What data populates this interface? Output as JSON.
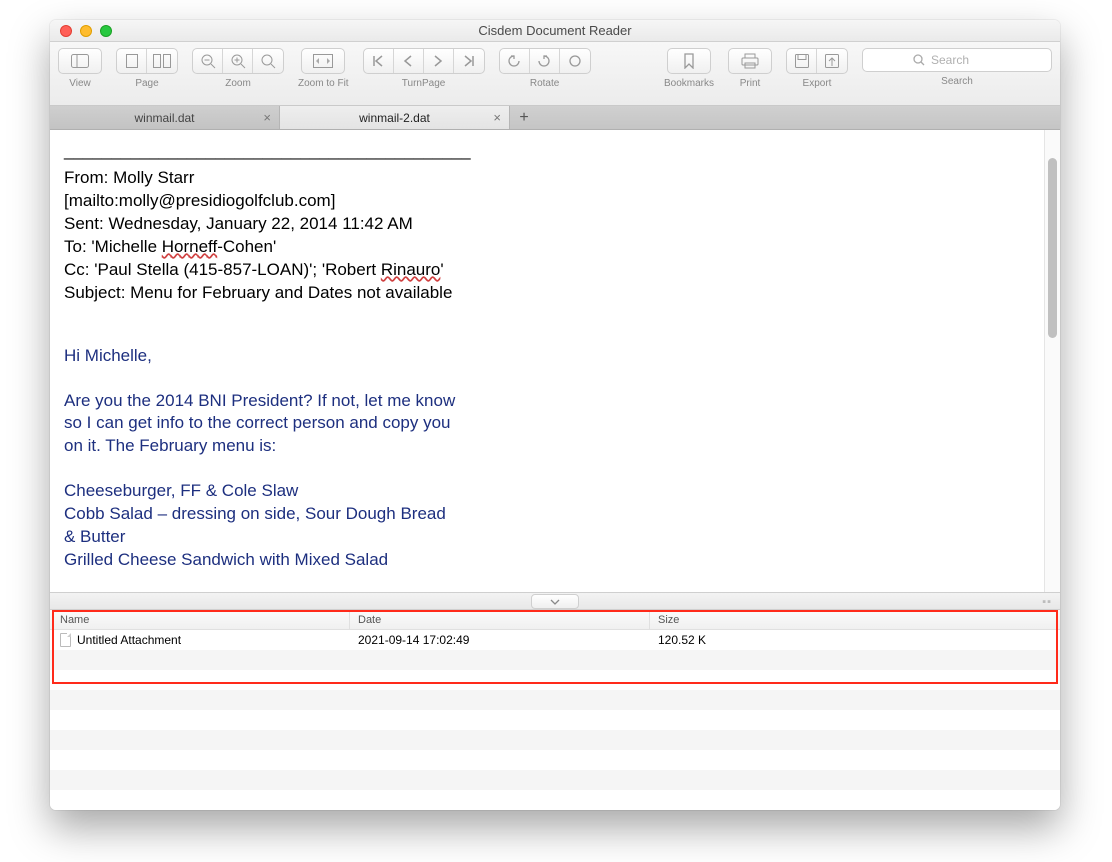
{
  "window": {
    "title": "Cisdem Document Reader"
  },
  "toolbar": {
    "view": "View",
    "page": "Page",
    "zoom": "Zoom",
    "zoom_to_fit": "Zoom to Fit",
    "turnpage": "TurnPage",
    "rotate": "Rotate",
    "bookmarks": "Bookmarks",
    "print": "Print",
    "export": "Export",
    "search_label": "Search",
    "search_placeholder": "Search"
  },
  "tabs": [
    {
      "label": "winmail.dat",
      "active": false
    },
    {
      "label": "winmail-2.dat",
      "active": true
    }
  ],
  "email": {
    "divider": "___________________________________________",
    "from_label": "From:",
    "from_name": "Molly Starr",
    "mailto": "[mailto:molly@presidiogolfclub.com]",
    "sent_label": "Sent:",
    "sent_value": "Wednesday, January 22, 2014 11:42 AM",
    "to_label": "To:",
    "to_value": "'Michelle Horneff-Cohen'",
    "cc_label": "Cc:",
    "cc_value": "'Paul Stella (415-857-LOAN)'; 'Robert Rinauro'",
    "subject_label": "Subject:",
    "subject_value": "Menu for February and Dates not available",
    "body": {
      "greeting": "Hi Michelle,",
      "p1l1": "Are you the 2014 BNI President?  If not, let me know",
      "p1l2": "so I can get info to the correct person and copy you",
      "p1l3": "on it.  The February menu is:",
      "m1": "Cheeseburger, FF & Cole Slaw",
      "m2a": "Cobb Salad – dressing on side, Sour Dough Bread",
      "m2b": "& Butter",
      "m3": "Grilled Cheese Sandwich with Mixed Salad"
    }
  },
  "attachments": {
    "headers": {
      "name": "Name",
      "date": "Date",
      "size": "Size"
    },
    "rows": [
      {
        "name": "Untitled Attachment",
        "date": "2021-09-14 17:02:49",
        "size": "120.52 K"
      }
    ]
  }
}
